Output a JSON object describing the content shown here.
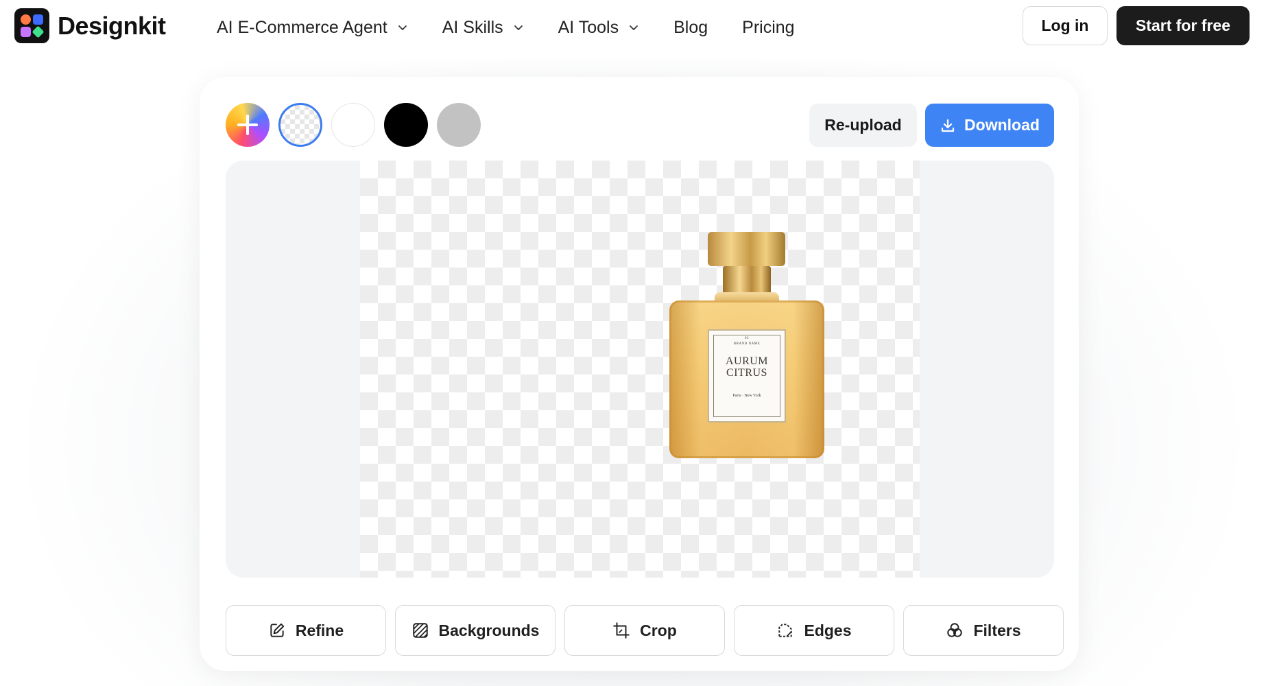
{
  "header": {
    "brand": "Designkit",
    "nav": [
      {
        "label": "AI E-Commerce Agent",
        "has_dropdown": true
      },
      {
        "label": "AI Skills",
        "has_dropdown": true
      },
      {
        "label": "AI Tools",
        "has_dropdown": true
      },
      {
        "label": "Blog",
        "has_dropdown": false
      },
      {
        "label": "Pricing",
        "has_dropdown": false
      }
    ],
    "login_label": "Log in",
    "start_label": "Start for free"
  },
  "toolbar": {
    "swatches": [
      {
        "name": "add-custom-color",
        "color": "gradient"
      },
      {
        "name": "transparent",
        "color": "transparent",
        "selected": true
      },
      {
        "name": "white",
        "color": "#FFFFFF"
      },
      {
        "name": "black",
        "color": "#000000"
      },
      {
        "name": "gray",
        "color": "#C2C2C2"
      }
    ],
    "reupload_label": "Re-upload",
    "download_label": "Download",
    "download_icon": "download-icon"
  },
  "preview": {
    "product_label": {
      "small": "03",
      "brand": "BRAND NAME",
      "line1": "AURUM",
      "line2": "CITRUS",
      "city": "Paris · New York"
    }
  },
  "tools": [
    {
      "label": "Refine",
      "icon": "edit-icon"
    },
    {
      "label": "Backgrounds",
      "icon": "pattern-icon"
    },
    {
      "label": "Crop",
      "icon": "crop-icon"
    },
    {
      "label": "Edges",
      "icon": "edges-icon"
    },
    {
      "label": "Filters",
      "icon": "filters-icon"
    }
  ],
  "colors": {
    "accent": "#3F84F5",
    "primary_button": "#1C1C1C"
  }
}
